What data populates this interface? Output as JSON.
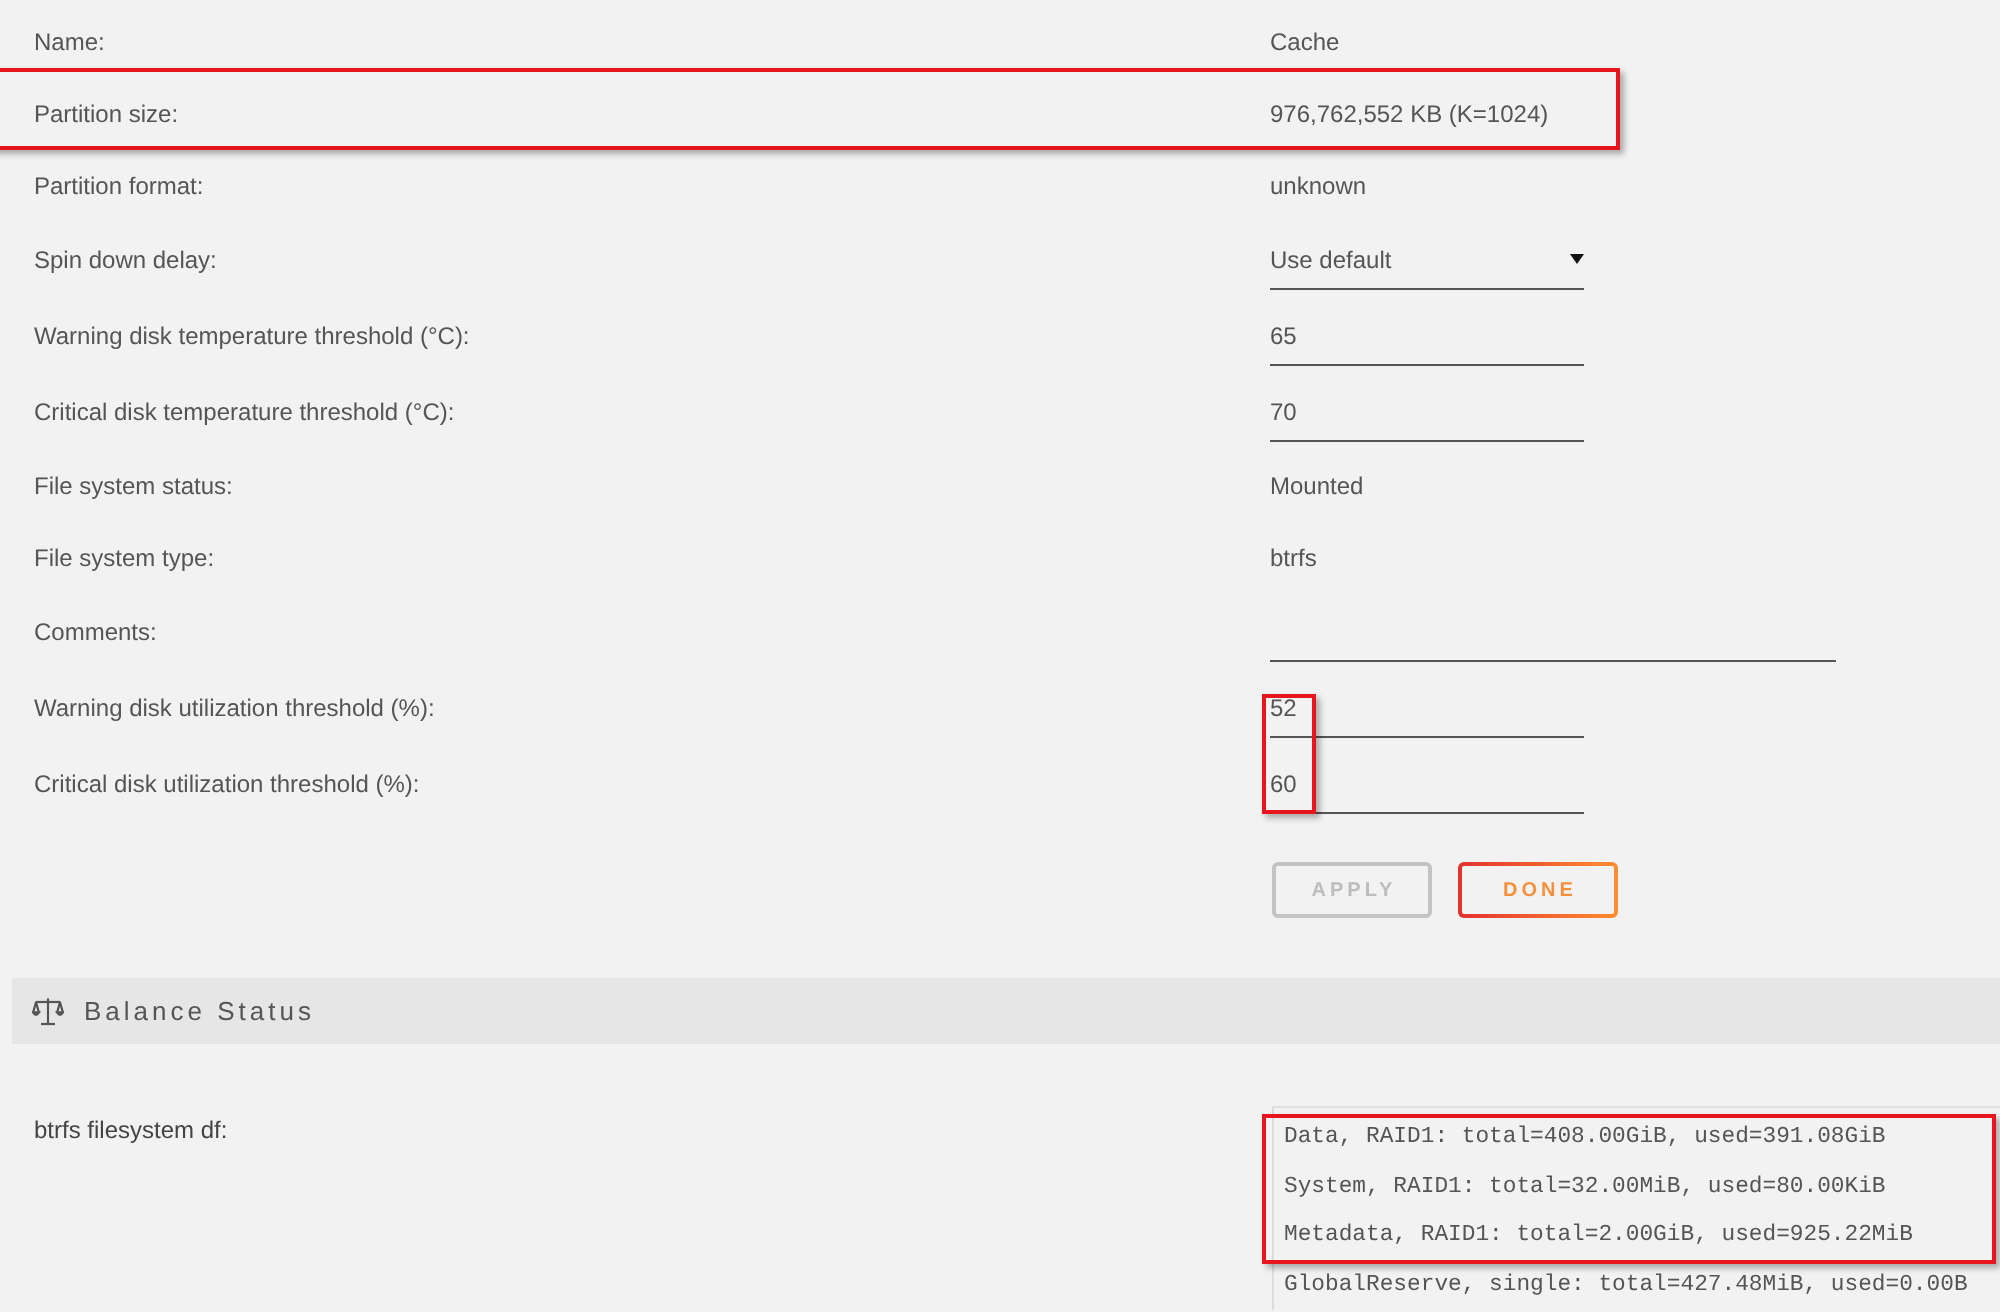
{
  "settings": {
    "fields": [
      {
        "label": "Name:",
        "kind": "text",
        "value": "Cache",
        "row_highlighted": false,
        "value_highlighted": false
      },
      {
        "label": "Partition size:",
        "kind": "text",
        "value": "976,762,552 KB (K=1024)",
        "row_highlighted": true,
        "value_highlighted": false
      },
      {
        "label": "Partition format:",
        "kind": "text",
        "value": "unknown",
        "row_highlighted": false,
        "value_highlighted": false
      },
      {
        "label": "Spin down delay:",
        "kind": "select",
        "value": "Use default",
        "row_highlighted": false,
        "value_highlighted": false
      },
      {
        "label": "Warning disk temperature threshold (°C):",
        "kind": "input",
        "value": "65",
        "row_highlighted": false,
        "value_highlighted": false
      },
      {
        "label": "Critical disk temperature threshold (°C):",
        "kind": "input",
        "value": "70",
        "row_highlighted": false,
        "value_highlighted": false
      },
      {
        "label": "File system status:",
        "kind": "text",
        "value": "Mounted",
        "row_highlighted": false,
        "value_highlighted": false
      },
      {
        "label": "File system type:",
        "kind": "text",
        "value": "btrfs",
        "row_highlighted": false,
        "value_highlighted": false
      },
      {
        "label": "Comments:",
        "kind": "wide",
        "row_highlighted": false,
        "value_highlighted": false
      },
      {
        "label": "Warning disk utilization threshold (%):",
        "kind": "input",
        "value": "52",
        "row_highlighted": false,
        "value_highlighted": true
      },
      {
        "label": "Critical disk utilization threshold (%):",
        "kind": "input",
        "value": "60",
        "row_highlighted": false,
        "value_highlighted": true
      }
    ],
    "buttons": [
      {
        "label": "APPLY",
        "disabled": true
      },
      {
        "label": "DONE",
        "disabled": false
      }
    ]
  },
  "balance_status": {
    "title": "Balance Status",
    "df": {
      "label": "btrfs filesystem df:",
      "lines": [
        {
          "text": "Data, RAID1: total=408.00GiB, used=391.08GiB",
          "highlighted": true
        },
        {
          "text": "System, RAID1: total=32.00MiB, used=80.00KiB",
          "highlighted": true
        },
        {
          "text": "Metadata, RAID1: total=2.00GiB, used=925.22MiB",
          "highlighted": true
        },
        {
          "text": "GlobalReserve, single: total=427.48MiB, used=0.00B",
          "highlighted": false
        }
      ]
    }
  }
}
